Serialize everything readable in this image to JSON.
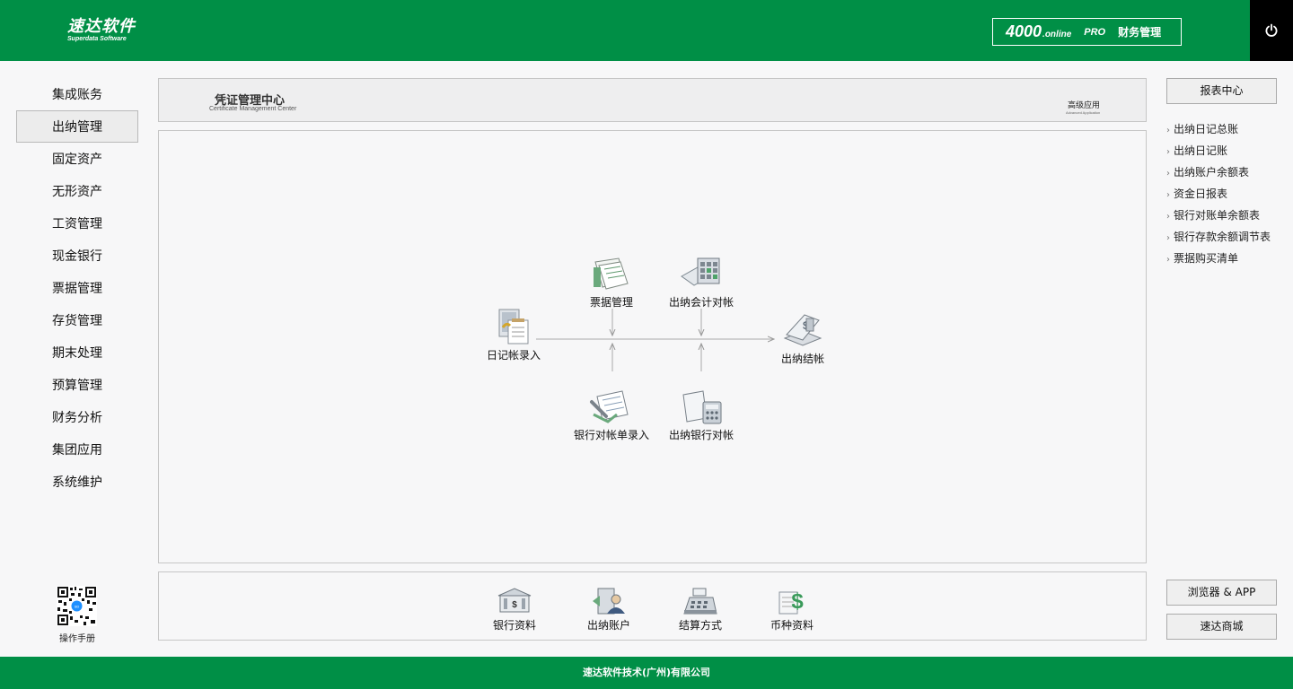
{
  "header": {
    "logo_cn": "速达软件",
    "logo_en": "Superdata Software",
    "product_num": "4000",
    "product_suffix": ".online",
    "product_pro": "PRO",
    "product_name": "财务管理",
    "power_icon": "power-icon"
  },
  "leftnav": {
    "items": [
      {
        "label": "集成账务"
      },
      {
        "label": "出纳管理"
      },
      {
        "label": "固定资产"
      },
      {
        "label": "无形资产"
      },
      {
        "label": "工资管理"
      },
      {
        "label": "现金银行"
      },
      {
        "label": "票据管理"
      },
      {
        "label": "存货管理"
      },
      {
        "label": "期末处理"
      },
      {
        "label": "预算管理"
      },
      {
        "label": "财务分析"
      },
      {
        "label": "集团应用"
      },
      {
        "label": "系统维护"
      }
    ],
    "active_index": 1,
    "manual_label": "操作手册"
  },
  "title_panel": {
    "title_cn": "凭证管理中心",
    "title_en": "Certificate Management Center",
    "advanced_cn": "高级应用",
    "advanced_en": "Advanced Application"
  },
  "flow": {
    "nodes": [
      {
        "label": "日记帐录入",
        "icon": "journal-entry-icon"
      },
      {
        "label": "票据管理",
        "icon": "bill-management-icon"
      },
      {
        "label": "出纳会计对帐",
        "icon": "cashier-reconcile-icon"
      },
      {
        "label": "出纳结帐",
        "icon": "cashier-close-icon"
      },
      {
        "label": "银行对帐单录入",
        "icon": "bank-statement-icon"
      },
      {
        "label": "出纳银行对帐",
        "icon": "bank-reconcile-icon"
      }
    ]
  },
  "bottom": {
    "items": [
      {
        "label": "银行资料",
        "icon": "bank-icon"
      },
      {
        "label": "出纳账户",
        "icon": "account-user-icon"
      },
      {
        "label": "结算方式",
        "icon": "cash-register-icon"
      },
      {
        "label": "币种资料",
        "icon": "currency-icon"
      }
    ]
  },
  "right": {
    "report_center": "报表中心",
    "reports": [
      "出纳日记总账",
      "出纳日记账",
      "出纳账户余额表",
      "资金日报表",
      "银行对账单余额表",
      "银行存款余额调节表",
      "票据购买清单"
    ],
    "browser_app": "浏览器 & APP",
    "mall": "速达商城"
  },
  "footer": {
    "company": "速达软件技术(广州)有限公司"
  },
  "colors": {
    "brand_green": "#008f46",
    "power_bg": "#000000"
  }
}
